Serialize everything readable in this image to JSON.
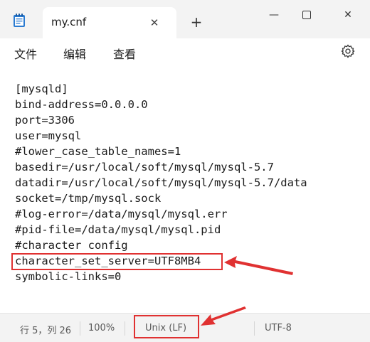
{
  "window": {
    "tab_title": "my.cnf"
  },
  "menu": {
    "file": "文件",
    "edit": "编辑",
    "view": "查看"
  },
  "editor": {
    "lines": [
      "[mysqld]",
      "bind-address=0.0.0.0",
      "port=3306",
      "user=mysql",
      "#lower_case_table_names=1",
      "basedir=/usr/local/soft/mysql/mysql-5.7",
      "datadir=/usr/local/soft/mysql/mysql-5.7/data",
      "socket=/tmp/mysql.sock",
      "#log-error=/data/mysql/mysql.err",
      "#pid-file=/data/mysql/mysql.pid",
      "#character config",
      "character_set_server=UTF8MB4",
      "symbolic-links=0"
    ]
  },
  "status": {
    "position": "行 5，列 26",
    "zoom": "100%",
    "line_ending": "Unix (LF)",
    "encoding": "UTF-8"
  },
  "icons": {
    "app": "notepad-icon",
    "close_tab": "close-icon",
    "new_tab": "plus-icon",
    "settings": "gear-icon"
  },
  "colors": {
    "annotation": "#e03131"
  }
}
